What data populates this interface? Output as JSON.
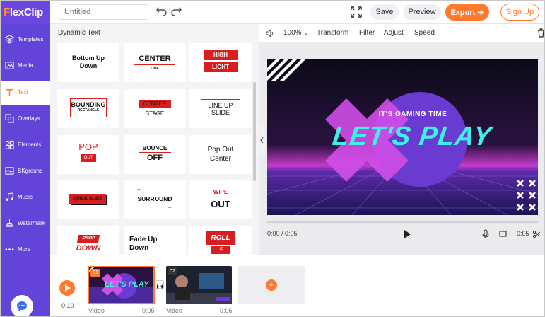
{
  "app": {
    "logo_text": "FlexClip",
    "logo_first": "F",
    "logo_rest": "lexClip"
  },
  "header": {
    "title_placeholder": "Untitled",
    "save_label": "Save",
    "preview_label": "Preview",
    "export_label": "Export",
    "signup_label": "Sign Up"
  },
  "sidebar": {
    "items": [
      {
        "label": "Templates",
        "icon": "templates-icon"
      },
      {
        "label": "Media",
        "icon": "media-icon"
      },
      {
        "label": "Text",
        "icon": "text-icon"
      },
      {
        "label": "Overlays",
        "icon": "overlays-icon"
      },
      {
        "label": "Elements",
        "icon": "elements-icon"
      },
      {
        "label": "BKground",
        "icon": "background-icon"
      },
      {
        "label": "Music",
        "icon": "music-icon"
      },
      {
        "label": "Watermark",
        "icon": "watermark-icon"
      },
      {
        "label": "More",
        "icon": "more-icon"
      }
    ],
    "active": "Text"
  },
  "panel": {
    "title": "Dynamic Text",
    "cards": {
      "c1": {
        "line1": "Bottom Up",
        "line2": "Down"
      },
      "c2": {
        "line1": "CENTER",
        "line2": "LINE"
      },
      "c3": {
        "line1": "HIGH",
        "line2": "LIGHT"
      },
      "c4": {
        "line1": "BOUNDING",
        "line2": "RECTANGLE"
      },
      "c5": {
        "line1": "CENTER",
        "line2": "STAGE"
      },
      "c6": {
        "line1": "LINE UP",
        "line2": "SLIDE"
      },
      "c7": {
        "line1": "POP",
        "line2": "OUT"
      },
      "c8": {
        "line1": "BOUNCE",
        "line2": "OFF"
      },
      "c9": {
        "line1": "Pop Out",
        "line2": "Center"
      },
      "c10": {
        "line1": "QUICK SLIDE"
      },
      "c11": {
        "line1": "SURROUND"
      },
      "c12": {
        "line1": "WIPE",
        "line2": "OUT"
      },
      "c13": {
        "line1": "DROP",
        "line2": "DOWN"
      },
      "c14": {
        "line1": "Fade Up",
        "line2": "Down"
      },
      "c15": {
        "line1": "ROLL",
        "line2": "UP"
      }
    }
  },
  "toolbar": {
    "zoom": "100%",
    "transform": "Transform",
    "filter": "Filter",
    "adjust": "Adjust",
    "speed": "Speed"
  },
  "video": {
    "subtitle": "IT'S GAMING TIME",
    "headline": "LET'S PLAY"
  },
  "player": {
    "time": "0:00 / 0:05",
    "duration": "0:05"
  },
  "timeline": {
    "current_time": "0:10",
    "clips": [
      {
        "index": "01",
        "type": "Video",
        "duration": "0:05",
        "thumb_text": "LET'S PLAY"
      },
      {
        "index": "02",
        "type": "Video",
        "duration": "0:06"
      }
    ]
  },
  "colors": {
    "brand_purple": "#6244d9",
    "accent_orange": "#ff7a2f",
    "red": "#d81e1e",
    "teal": "#3ff0e6",
    "magenta": "#e05be6"
  }
}
